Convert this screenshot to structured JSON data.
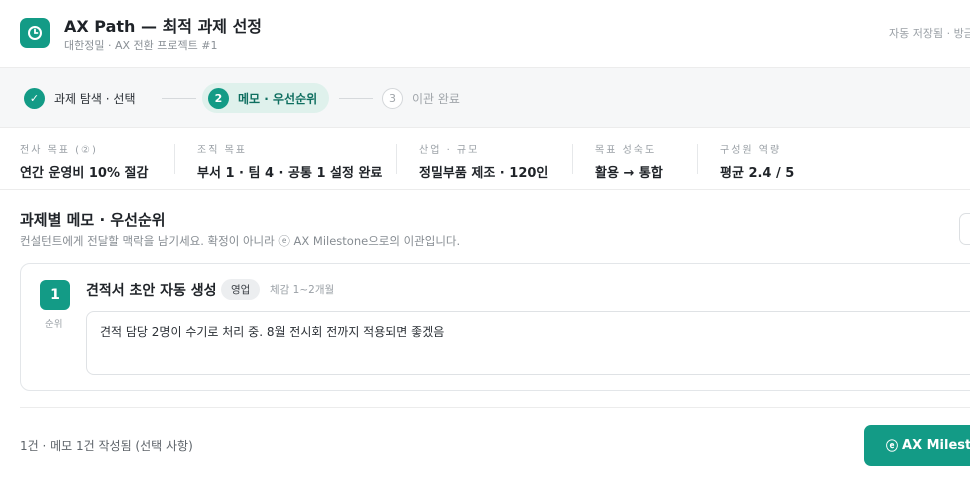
{
  "header": {
    "logo_icon": "clock-icon",
    "title": "AX Path — 최적 과제 선정",
    "subtitle": "대한정밀 · AX 전환 프로젝트 #1",
    "autosave": "자동 저장됨 · 방금"
  },
  "stepper": {
    "steps": [
      {
        "number": "✓",
        "label": "과제 탐색 · 선택",
        "state": "done"
      },
      {
        "number": "2",
        "label": "메모 · 우선순위",
        "state": "active"
      },
      {
        "number": "3",
        "label": "이관 완료",
        "state": "todo"
      }
    ]
  },
  "stats": [
    {
      "label": "전사 목표 (②)",
      "value": "연간 운영비 10% 절감"
    },
    {
      "label": "조직 목표",
      "value": "부서 1 · 팀 4 · 공통 1 설정 완료"
    },
    {
      "label": "산업 · 규모",
      "value": "정밀부품 제조 · 120인"
    },
    {
      "label": "목표 성숙도",
      "value": "활용 → 통합"
    },
    {
      "label": "구성원 역량",
      "value": "평균 2.4 / 5"
    }
  ],
  "section": {
    "title": "과제별 메모 · 우선순위",
    "description": "컨설턴트에게 전달할 맥락을 남기세요. 확정이 아니라 ⓔ AX Milestone으로의 이관입니다."
  },
  "tasks": [
    {
      "rank": "1",
      "rank_label": "순위",
      "title": "견적서 초안 자동 생성",
      "department": "영업",
      "period": "체감 1~2개월",
      "memo": "견적 담당 2명이 수기로 처리 중. 8월 전시회 전까지 적용되면 좋겠음"
    }
  ],
  "footer": {
    "status": "1건 · 메모 1건 작성됨 (선택 사항)",
    "cta_icon": "ⓔ",
    "cta_label": "AX Milestone"
  },
  "colors": {
    "accent": "#139b86",
    "accent_soft": "#dff1ec"
  }
}
